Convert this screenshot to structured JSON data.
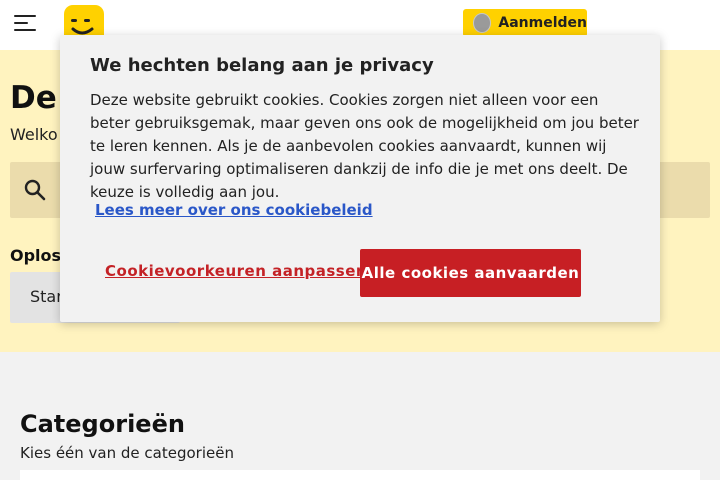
{
  "header": {
    "menu_icon": "hamburger-menu-icon",
    "logo_icon": "smiley-logo-icon",
    "login_label": "Aanmelden",
    "login_icon": "avatar-icon"
  },
  "hero": {
    "title": "De",
    "subtitle": "Welko",
    "search_icon": "search-icon",
    "solutions_label": "Oploss",
    "start_button_label": "Star"
  },
  "categories": {
    "title": "Categorieën",
    "subtitle": "Kies één van de categorieën"
  },
  "cookie_banner": {
    "title": "We hechten belang aan je privacy",
    "body": "Deze website gebruikt cookies. Cookies zorgen niet alleen voor een beter gebruiksgemak, maar geven ons ook de mogelijkheid om jou beter te leren kennen. Als je de aanbevolen cookies aanvaardt, kunnen wij jouw surfervaring optimaliseren dankzij de info die je met ons deelt. De keuze is volledig aan jou.",
    "policy_link": "Lees meer over ons cookiebeleid",
    "preferences_link": "Cookievoorkeuren aanpassen",
    "accept_button": "Alle cookies aanvaarden"
  },
  "colors": {
    "brand_yellow": "#ffd100",
    "hero_background": "#fff3bf",
    "accept_red": "#c71f24",
    "link_blue": "#2a57c8"
  }
}
